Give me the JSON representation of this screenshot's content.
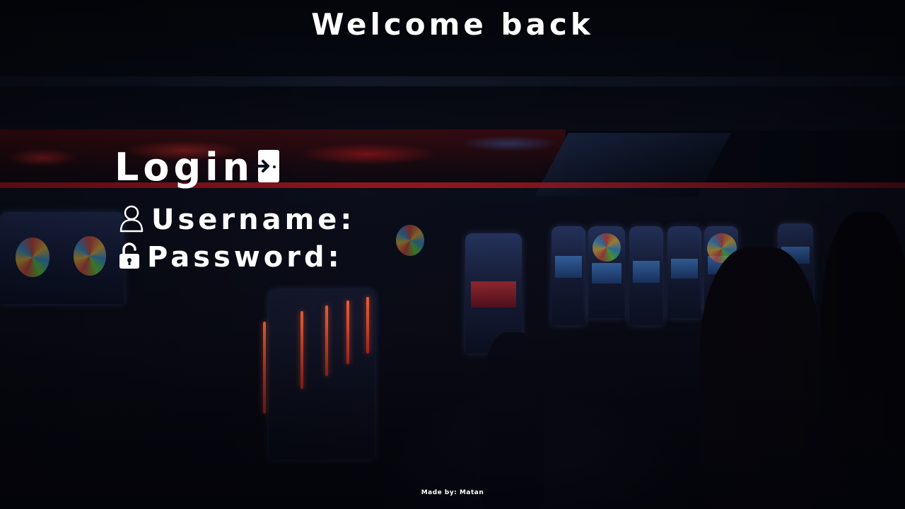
{
  "header": {
    "welcome_text": "Welcome back"
  },
  "login_form": {
    "title": "Login",
    "title_icon": "door-enter-icon",
    "username": {
      "icon": "user-icon",
      "label": "Username:",
      "value": "",
      "placeholder": ""
    },
    "password": {
      "icon": "lock-icon",
      "label": "Password:",
      "value": "",
      "placeholder": ""
    }
  },
  "footer": {
    "credit": "Made by: Matan"
  },
  "colors": {
    "text": "#ffffff",
    "background": "#060812"
  }
}
